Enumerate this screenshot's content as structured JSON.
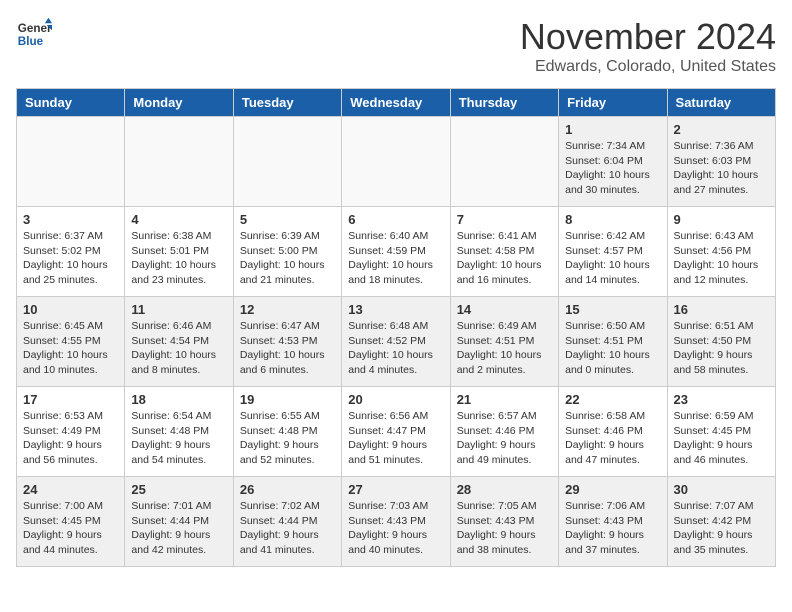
{
  "header": {
    "logo_line1": "General",
    "logo_line2": "Blue",
    "month": "November 2024",
    "location": "Edwards, Colorado, United States"
  },
  "weekdays": [
    "Sunday",
    "Monday",
    "Tuesday",
    "Wednesday",
    "Thursday",
    "Friday",
    "Saturday"
  ],
  "weeks": [
    [
      {
        "day": "",
        "info": ""
      },
      {
        "day": "",
        "info": ""
      },
      {
        "day": "",
        "info": ""
      },
      {
        "day": "",
        "info": ""
      },
      {
        "day": "",
        "info": ""
      },
      {
        "day": "1",
        "info": "Sunrise: 7:34 AM\nSunset: 6:04 PM\nDaylight: 10 hours and 30 minutes."
      },
      {
        "day": "2",
        "info": "Sunrise: 7:36 AM\nSunset: 6:03 PM\nDaylight: 10 hours and 27 minutes."
      }
    ],
    [
      {
        "day": "3",
        "info": "Sunrise: 6:37 AM\nSunset: 5:02 PM\nDaylight: 10 hours and 25 minutes."
      },
      {
        "day": "4",
        "info": "Sunrise: 6:38 AM\nSunset: 5:01 PM\nDaylight: 10 hours and 23 minutes."
      },
      {
        "day": "5",
        "info": "Sunrise: 6:39 AM\nSunset: 5:00 PM\nDaylight: 10 hours and 21 minutes."
      },
      {
        "day": "6",
        "info": "Sunrise: 6:40 AM\nSunset: 4:59 PM\nDaylight: 10 hours and 18 minutes."
      },
      {
        "day": "7",
        "info": "Sunrise: 6:41 AM\nSunset: 4:58 PM\nDaylight: 10 hours and 16 minutes."
      },
      {
        "day": "8",
        "info": "Sunrise: 6:42 AM\nSunset: 4:57 PM\nDaylight: 10 hours and 14 minutes."
      },
      {
        "day": "9",
        "info": "Sunrise: 6:43 AM\nSunset: 4:56 PM\nDaylight: 10 hours and 12 minutes."
      }
    ],
    [
      {
        "day": "10",
        "info": "Sunrise: 6:45 AM\nSunset: 4:55 PM\nDaylight: 10 hours and 10 minutes."
      },
      {
        "day": "11",
        "info": "Sunrise: 6:46 AM\nSunset: 4:54 PM\nDaylight: 10 hours and 8 minutes."
      },
      {
        "day": "12",
        "info": "Sunrise: 6:47 AM\nSunset: 4:53 PM\nDaylight: 10 hours and 6 minutes."
      },
      {
        "day": "13",
        "info": "Sunrise: 6:48 AM\nSunset: 4:52 PM\nDaylight: 10 hours and 4 minutes."
      },
      {
        "day": "14",
        "info": "Sunrise: 6:49 AM\nSunset: 4:51 PM\nDaylight: 10 hours and 2 minutes."
      },
      {
        "day": "15",
        "info": "Sunrise: 6:50 AM\nSunset: 4:51 PM\nDaylight: 10 hours and 0 minutes."
      },
      {
        "day": "16",
        "info": "Sunrise: 6:51 AM\nSunset: 4:50 PM\nDaylight: 9 hours and 58 minutes."
      }
    ],
    [
      {
        "day": "17",
        "info": "Sunrise: 6:53 AM\nSunset: 4:49 PM\nDaylight: 9 hours and 56 minutes."
      },
      {
        "day": "18",
        "info": "Sunrise: 6:54 AM\nSunset: 4:48 PM\nDaylight: 9 hours and 54 minutes."
      },
      {
        "day": "19",
        "info": "Sunrise: 6:55 AM\nSunset: 4:48 PM\nDaylight: 9 hours and 52 minutes."
      },
      {
        "day": "20",
        "info": "Sunrise: 6:56 AM\nSunset: 4:47 PM\nDaylight: 9 hours and 51 minutes."
      },
      {
        "day": "21",
        "info": "Sunrise: 6:57 AM\nSunset: 4:46 PM\nDaylight: 9 hours and 49 minutes."
      },
      {
        "day": "22",
        "info": "Sunrise: 6:58 AM\nSunset: 4:46 PM\nDaylight: 9 hours and 47 minutes."
      },
      {
        "day": "23",
        "info": "Sunrise: 6:59 AM\nSunset: 4:45 PM\nDaylight: 9 hours and 46 minutes."
      }
    ],
    [
      {
        "day": "24",
        "info": "Sunrise: 7:00 AM\nSunset: 4:45 PM\nDaylight: 9 hours and 44 minutes."
      },
      {
        "day": "25",
        "info": "Sunrise: 7:01 AM\nSunset: 4:44 PM\nDaylight: 9 hours and 42 minutes."
      },
      {
        "day": "26",
        "info": "Sunrise: 7:02 AM\nSunset: 4:44 PM\nDaylight: 9 hours and 41 minutes."
      },
      {
        "day": "27",
        "info": "Sunrise: 7:03 AM\nSunset: 4:43 PM\nDaylight: 9 hours and 40 minutes."
      },
      {
        "day": "28",
        "info": "Sunrise: 7:05 AM\nSunset: 4:43 PM\nDaylight: 9 hours and 38 minutes."
      },
      {
        "day": "29",
        "info": "Sunrise: 7:06 AM\nSunset: 4:43 PM\nDaylight: 9 hours and 37 minutes."
      },
      {
        "day": "30",
        "info": "Sunrise: 7:07 AM\nSunset: 4:42 PM\nDaylight: 9 hours and 35 minutes."
      }
    ]
  ]
}
